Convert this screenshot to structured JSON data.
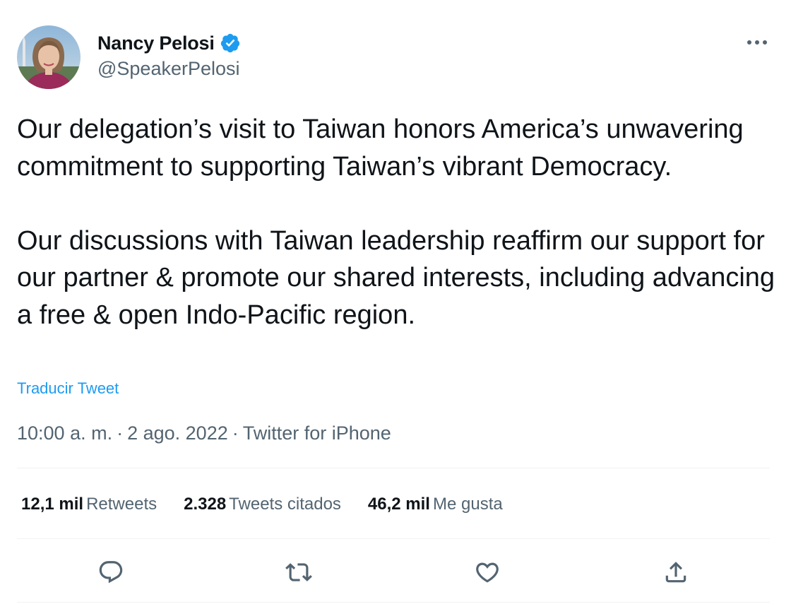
{
  "author": {
    "display_name": "Nancy Pelosi",
    "handle": "@SpeakerPelosi",
    "verified": true,
    "avatar_icon": "profile-photo"
  },
  "tweet": {
    "paragraphs": [
      "Our delegation’s visit to Taiwan honors America’s unwavering commitment to supporting Taiwan’s vibrant Democracy.",
      "Our discussions with Taiwan leadership reaffirm our support for our partner & promote our shared interests, including advancing a free & open Indo-Pacific region."
    ],
    "translate_label": "Traducir Tweet",
    "time": "10:00 a. m.",
    "date": "2 ago. 2022",
    "source": "Twitter for iPhone",
    "separator": "·"
  },
  "stats": {
    "retweets": {
      "value": "12,1 mil",
      "label": "Retweets"
    },
    "quotes": {
      "value": "2.328",
      "label": "Tweets citados"
    },
    "likes": {
      "value": "46,2 mil",
      "label": "Me gusta"
    }
  },
  "actions": {
    "reply_icon": "reply-icon",
    "retweet_icon": "retweet-icon",
    "like_icon": "heart-icon",
    "share_icon": "share-icon"
  },
  "colors": {
    "accent": "#1d9bf0",
    "secondary_text": "#536471",
    "primary_text": "#0f1419",
    "divider": "#eff3f4"
  }
}
